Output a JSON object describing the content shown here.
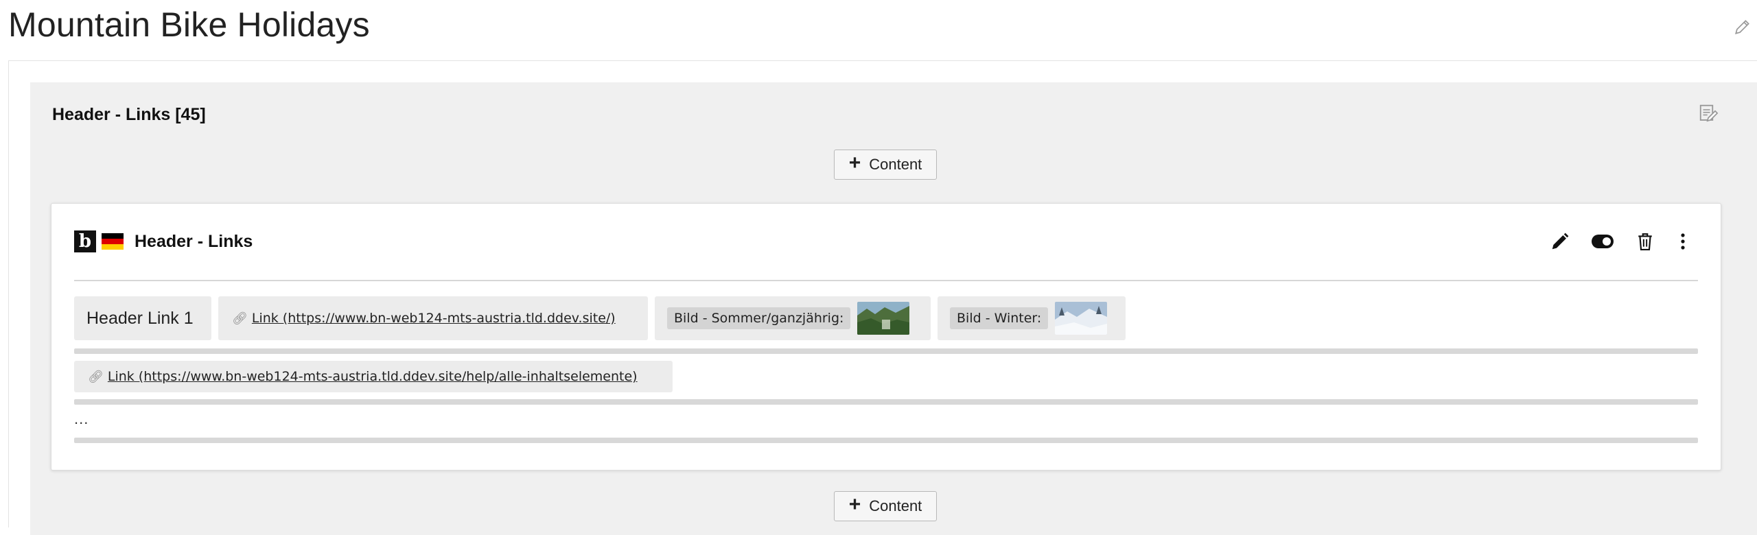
{
  "page": {
    "title": "Mountain Bike Holidays"
  },
  "container": {
    "title": "Header - Links [45]"
  },
  "content_button": {
    "label": "Content"
  },
  "element": {
    "title": "Header - Links",
    "type_icon_letter": "b",
    "language_flag": "de",
    "field_title": "Header Link 1",
    "link1_text": " Link (https://www.bn-web124-mts-austria.tld.ddev.site/)",
    "image_summer_label": "Bild - Sommer/ganzjährig:",
    "image_winter_label": "Bild - Winter:",
    "link2_text": " Link (https://www.bn-web124-mts-austria.tld.ddev.site/help/alle-inhaltselemente)",
    "more_indicator": "..."
  },
  "colors": {
    "background": "#ffffff",
    "grid_background": "#f0f0f0",
    "chip_background": "#ececec",
    "flag_black": "#000000",
    "flag_red": "#dd0000",
    "flag_gold": "#ffce00"
  },
  "icons": {
    "title_edit": "pencil-icon",
    "container_edit": "edit-document-icon",
    "add": "plus-icon",
    "edit": "pencil-icon",
    "toggle": "toggle-icon",
    "delete": "trash-icon",
    "more": "more-vertical-icon",
    "link": "link-icon"
  }
}
